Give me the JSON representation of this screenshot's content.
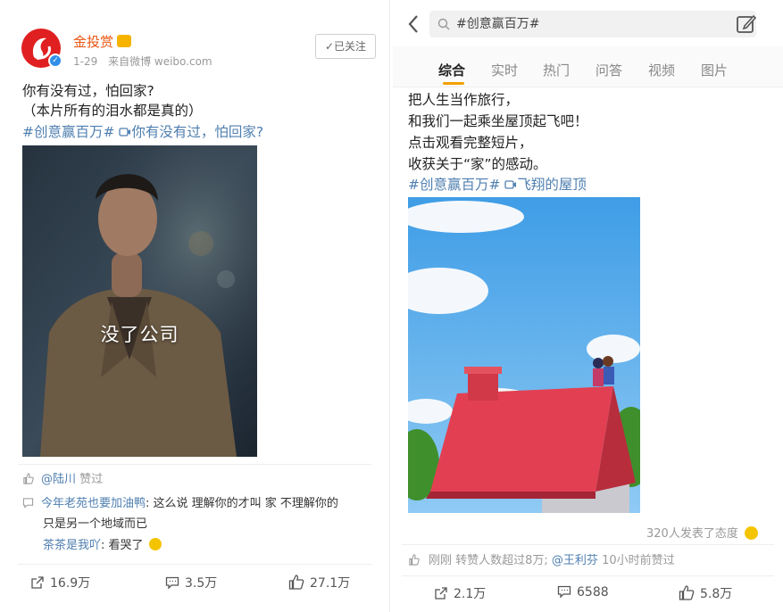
{
  "left": {
    "username": "金投赏",
    "date": "1-29",
    "source": "来自微博 weibo.com",
    "follow_label": "✓已关注",
    "text_line1": "你有没有过，怕回家?",
    "text_line2": "（本片所有的泪水都是真的）",
    "hashtag": "#创意赢百万#",
    "video_link": "你有没有过，怕回家?",
    "video_caption": "没了公司",
    "liker": "@陆川",
    "liked_label": "赞过",
    "comment1_user": "今年老苑也要加油鸭",
    "comment1_text": ": 这么说 理解你的才叫 家 不理解你的",
    "comment1_text2": "只是另一个地域而已",
    "comment2_user": "茶茶是我吖",
    "comment2_text": ": 看哭了",
    "repost_count": "16.9万",
    "comment_count": "3.5万",
    "like_count": "27.1万"
  },
  "right": {
    "search_query": "#创意赢百万#",
    "tabs": [
      "综合",
      "实时",
      "热门",
      "问答",
      "视频",
      "图片"
    ],
    "active_tab": "综合",
    "line1": "把人生当作旅行，",
    "line2": "和我们一起乘坐屋顶起飞吧！",
    "line3": "点击观看完整短片，",
    "line4": "收获关于“家”的感动。",
    "hashtag": "#创意赢百万#",
    "video_link": "飞翔的屋顶",
    "reactions": "320人发表了态度",
    "activity": "刚刚 转赞人数超过8万; ",
    "activity_user": "@王利芬",
    "activity_time": " 10小时前赞过",
    "repost_count": "2.1万",
    "comment_count": "6588",
    "like_count": "5.8万"
  },
  "colors": {
    "orange_name": "#e8540f",
    "link": "#4f7fb0",
    "text": "#222222",
    "muted": "#999999"
  }
}
